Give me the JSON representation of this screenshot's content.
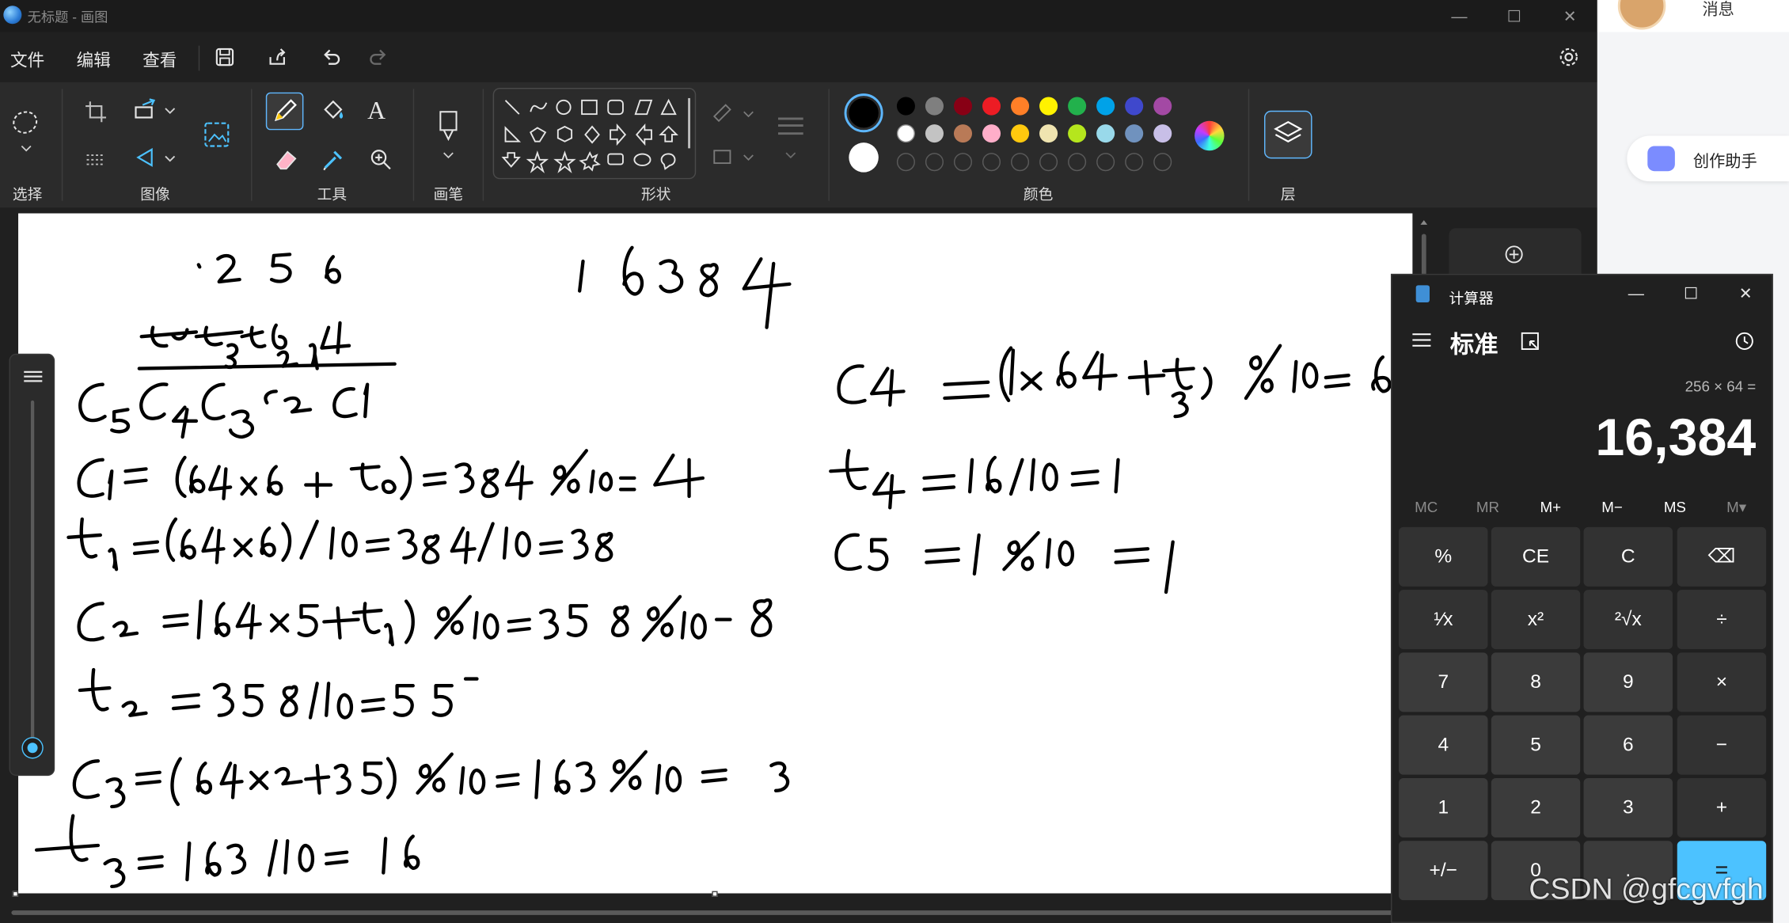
{
  "paint": {
    "title": "无标题 - 画图",
    "menu": {
      "file": "文件",
      "edit": "编辑",
      "view": "查看"
    },
    "groups": {
      "select": "选择",
      "image": "图像",
      "tools": "工具",
      "brushes": "画笔",
      "shapes": "形状",
      "colors": "颜色",
      "layers": "层"
    },
    "text_tool_glyph": "A",
    "palette_row1": [
      "#000000",
      "#7f7f7f",
      "#880015",
      "#ed1c24",
      "#ff7f27",
      "#fff200",
      "#22b14c",
      "#00a2e8",
      "#3f48cc",
      "#a349a4"
    ],
    "palette_row2": [
      "#ffffff",
      "#c3c3c3",
      "#b97a57",
      "#ffaec9",
      "#ffc90e",
      "#efe4b0",
      "#b5e61d",
      "#99d9ea",
      "#7092be",
      "#c8bfe7"
    ],
    "accent": "#4cc2ff"
  },
  "background_app": {
    "message_label": "消息",
    "assistant_label": "创作助手"
  },
  "calculator": {
    "title": "计算器",
    "mode": "标准",
    "expression": "256 × 64 =",
    "result": "16,384",
    "memory": [
      "MC",
      "MR",
      "M+",
      "M−",
      "MS",
      "M▾"
    ],
    "keys": [
      [
        "%",
        "CE",
        "C",
        "⌫"
      ],
      [
        "¹⁄x",
        "x²",
        "²√x",
        "÷"
      ],
      [
        "7",
        "8",
        "9",
        "×"
      ],
      [
        "4",
        "5",
        "6",
        "−"
      ],
      [
        "1",
        "2",
        "3",
        "+"
      ],
      [
        "+/−",
        "0",
        ".",
        "="
      ]
    ]
  },
  "watermark": "CSDN @gfcgvfgh"
}
